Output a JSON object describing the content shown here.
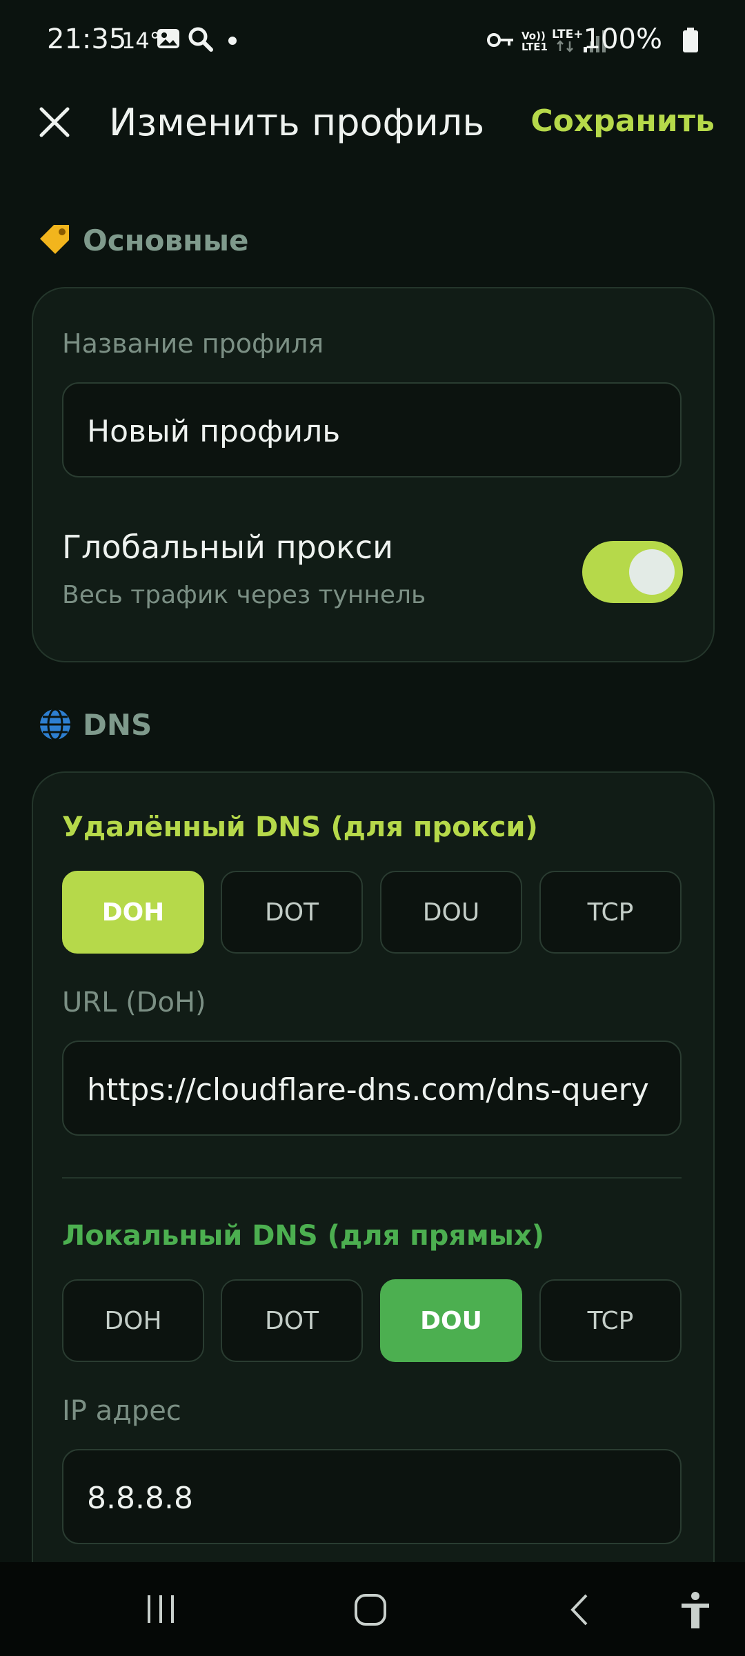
{
  "status_bar": {
    "time": "21:35",
    "temp": "14°",
    "battery": "100%",
    "net_top": "LTE+",
    "volte": "Vo))",
    "sim": "LTE1"
  },
  "app_bar": {
    "title": "Изменить профиль",
    "save_label": "Сохранить"
  },
  "section_basic": {
    "header": "Основные",
    "profile_name_label": "Название профиля",
    "profile_name_value": "Новый профиль",
    "global_proxy_title": "Глобальный прокси",
    "global_proxy_subtitle": "Весь трафик через туннель",
    "global_proxy_on": true
  },
  "section_dns": {
    "header": "DNS",
    "remote": {
      "title": "Удалённый DNS (для прокси)",
      "options": [
        "DOH",
        "DOT",
        "DOU",
        "TCP"
      ],
      "selected": "DOH",
      "url_label": "URL (DoH)",
      "url_value": "https://cloudflare-dns.com/dns-query"
    },
    "local": {
      "title": "Локальный DNS (для прямых)",
      "options": [
        "DOH",
        "DOT",
        "DOU",
        "TCP"
      ],
      "selected": "DOU",
      "ip_label": "IP адрес",
      "ip_value": "8.8.8.8"
    }
  },
  "colors": {
    "accent_lime": "#b6d94a",
    "accent_green": "#4caf50",
    "background": "#0b130f",
    "card": "#111c16"
  }
}
